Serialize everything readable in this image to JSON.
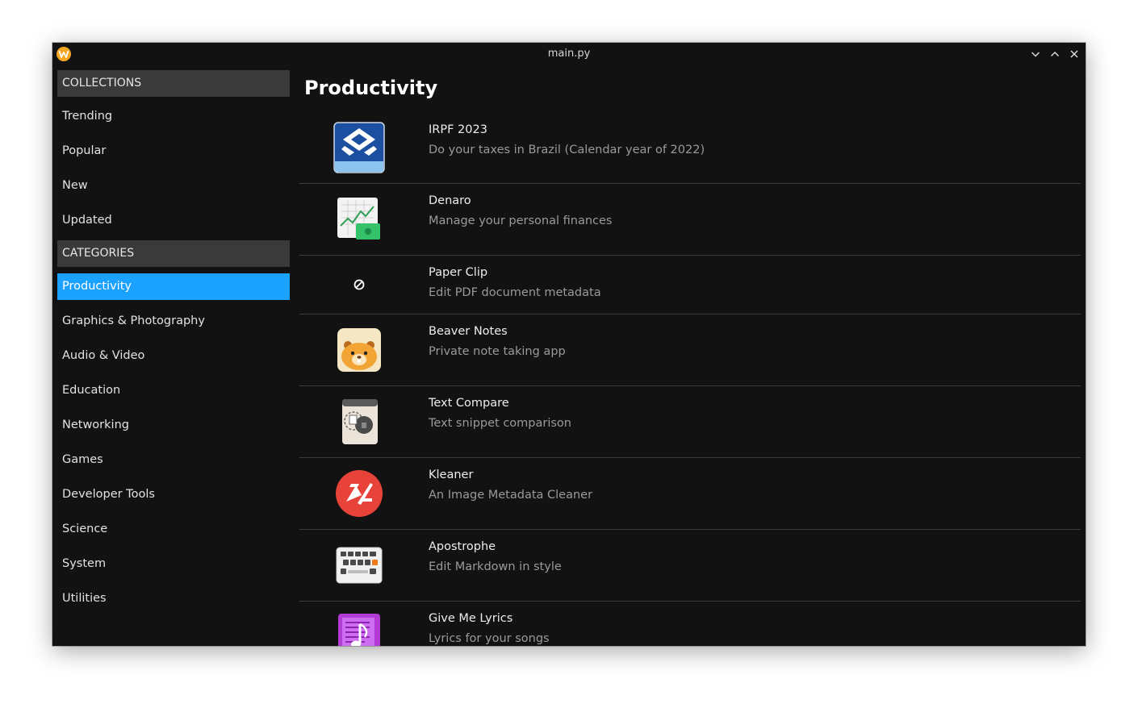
{
  "window": {
    "title": "main.py"
  },
  "sidebar": {
    "collections_header": "COLLECTIONS",
    "collections": [
      {
        "label": "Trending"
      },
      {
        "label": "Popular"
      },
      {
        "label": "New"
      },
      {
        "label": "Updated"
      }
    ],
    "categories_header": "CATEGORIES",
    "categories": [
      {
        "label": "Productivity",
        "active": true
      },
      {
        "label": "Graphics & Photography"
      },
      {
        "label": "Audio & Video"
      },
      {
        "label": "Education"
      },
      {
        "label": "Networking"
      },
      {
        "label": "Games"
      },
      {
        "label": "Developer Tools"
      },
      {
        "label": "Science"
      },
      {
        "label": "System"
      },
      {
        "label": "Utilities"
      }
    ]
  },
  "main": {
    "title": "Productivity",
    "apps": [
      {
        "name": "IRPF 2023",
        "description": "Do your taxes in Brazil (Calendar year of 2022)",
        "icon": "irpf-icon"
      },
      {
        "name": "Denaro",
        "description": "Manage your personal finances",
        "icon": "denaro-icon"
      },
      {
        "name": "Paper Clip",
        "description": "Edit PDF document metadata",
        "icon": "missing-image-icon"
      },
      {
        "name": "Beaver Notes",
        "description": "Private note taking app",
        "icon": "beaver-icon"
      },
      {
        "name": "Text Compare",
        "description": "Text snippet comparison",
        "icon": "text-compare-icon"
      },
      {
        "name": "Kleaner",
        "description": "An Image Metadata Cleaner",
        "icon": "kleaner-icon"
      },
      {
        "name": "Apostrophe",
        "description": "Edit Markdown in style",
        "icon": "keyboard-icon"
      },
      {
        "name": "Give Me Lyrics",
        "description": "Lyrics for your songs",
        "icon": "lyrics-icon"
      }
    ]
  },
  "colors": {
    "background": "#121212",
    "section_header": "#3a3a3a",
    "accent": "#1ba1ff",
    "separator": "#3c3c3c"
  }
}
